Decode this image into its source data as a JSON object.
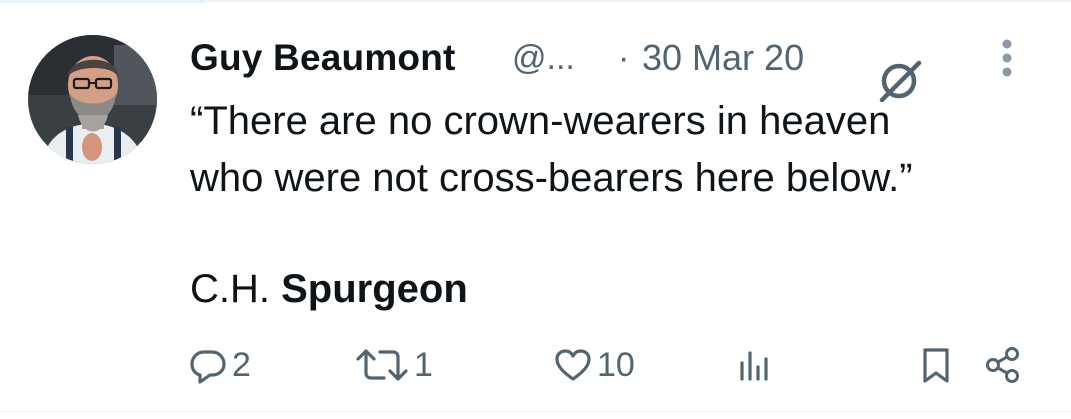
{
  "tweet": {
    "author": {
      "display_name": "Guy Beaumont",
      "handle": "@...",
      "avatar_icon": "user-avatar-photo"
    },
    "separator": "·",
    "timestamp": "30 Mar 20",
    "grok_icon": "grok-icon",
    "more_icon": "more-vertical-icon",
    "text_lines": [
      "“There are no crown-wearers in heaven",
      "who were not cross-bearers here below.”"
    ],
    "attribution": {
      "initials": "C.H. ",
      "surname": "Spurgeon"
    },
    "actions": {
      "reply": {
        "icon": "reply-icon",
        "count": "2"
      },
      "repost": {
        "icon": "repost-icon",
        "count": "1"
      },
      "like": {
        "icon": "heart-icon",
        "count": "10"
      },
      "views": {
        "icon": "views-icon",
        "count": ""
      },
      "bookmark": {
        "icon": "bookmark-icon"
      },
      "share": {
        "icon": "share-icon"
      }
    }
  },
  "colors": {
    "primary_text": "#0f1419",
    "secondary_text": "#536471",
    "divider": "#eff3f4",
    "background": "#ffffff"
  }
}
